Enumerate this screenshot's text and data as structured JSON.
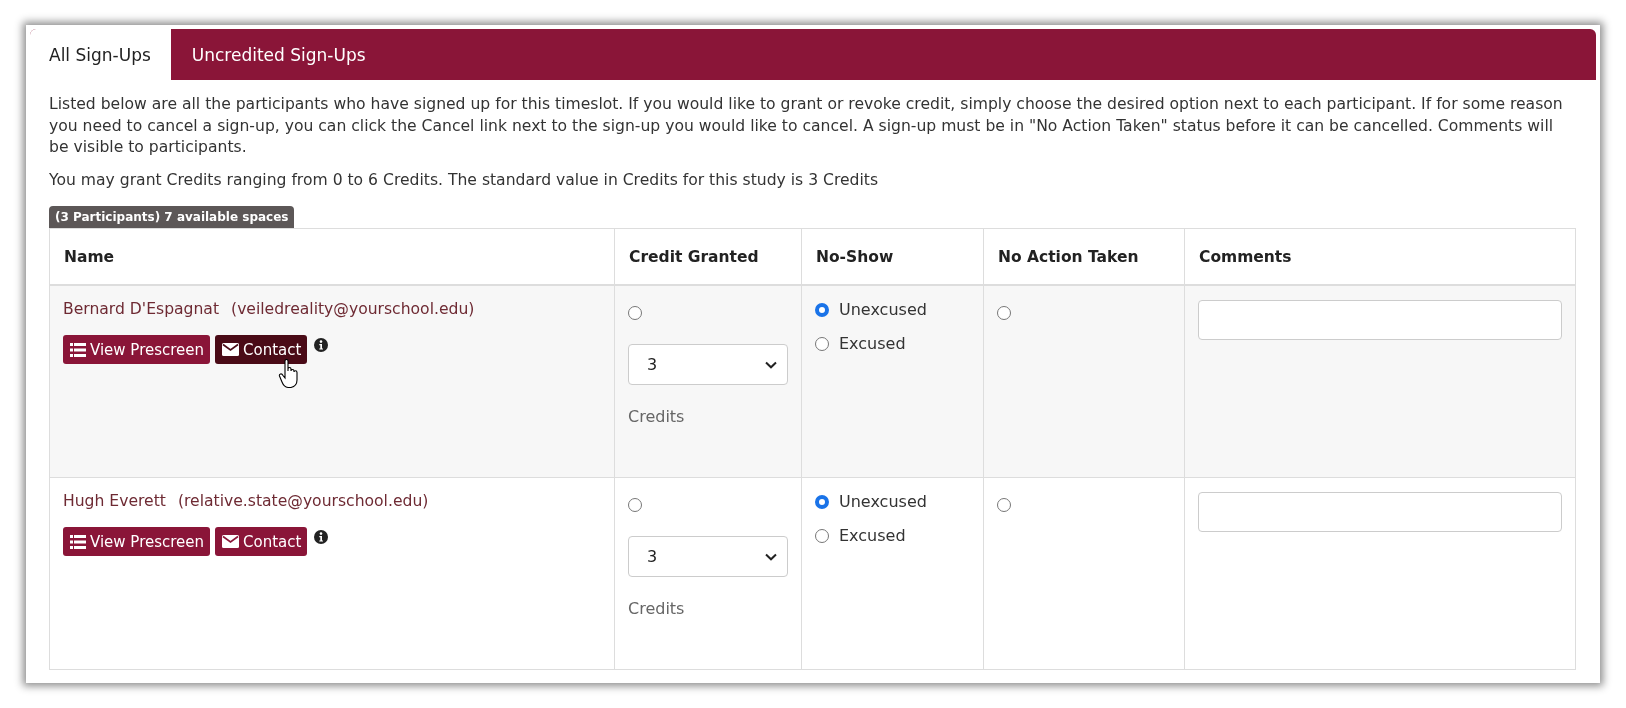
{
  "tabs": [
    {
      "label": "All Sign-Ups",
      "selected": true
    },
    {
      "label": "Uncredited Sign-Ups",
      "selected": false
    }
  ],
  "intro": "Listed below are all the participants who have signed up for this timeslot. If you would like to grant or revoke credit, simply choose the desired option next to each participant. If for some reason you need to cancel a sign-up, you can click the Cancel link next to the sign-up you would like to cancel. A sign-up must be in \"No Action Taken\" status before it can be cancelled. Comments will be visible to participants.",
  "credit_note": "You may grant Credits ranging from 0 to 6 Credits. The standard value in Credits for this study is 3 Credits",
  "badge": "(3 Participants) 7 available spaces",
  "table": {
    "columns": [
      "Name",
      "Credit Granted",
      "No-Show",
      "No Action Taken",
      "Comments"
    ],
    "rows": [
      {
        "name": "Bernard D'Espagnat",
        "email": "(veiledreality@yourschool.edu)",
        "buttons": [
          {
            "kind": "prescreen",
            "label": "View Prescreen",
            "hovered": false
          },
          {
            "kind": "contact",
            "label": "Contact",
            "hovered": true
          }
        ],
        "credit_selected": false,
        "credits_value": "3",
        "credits_unit": "Credits",
        "no_show": [
          {
            "label": "Unexcused",
            "selected": true
          },
          {
            "label": "Excused",
            "selected": false
          }
        ],
        "no_action_selected": false
      },
      {
        "name": "Hugh Everett",
        "email": "(relative.state@yourschool.edu)",
        "buttons": [
          {
            "kind": "prescreen",
            "label": "View Prescreen",
            "hovered": false
          },
          {
            "kind": "contact",
            "label": "Contact",
            "hovered": false
          }
        ],
        "credit_selected": false,
        "credits_value": "3",
        "credits_unit": "Credits",
        "no_show": [
          {
            "label": "Unexcused",
            "selected": true
          },
          {
            "label": "Excused",
            "selected": false
          }
        ],
        "no_action_selected": false
      }
    ]
  }
}
